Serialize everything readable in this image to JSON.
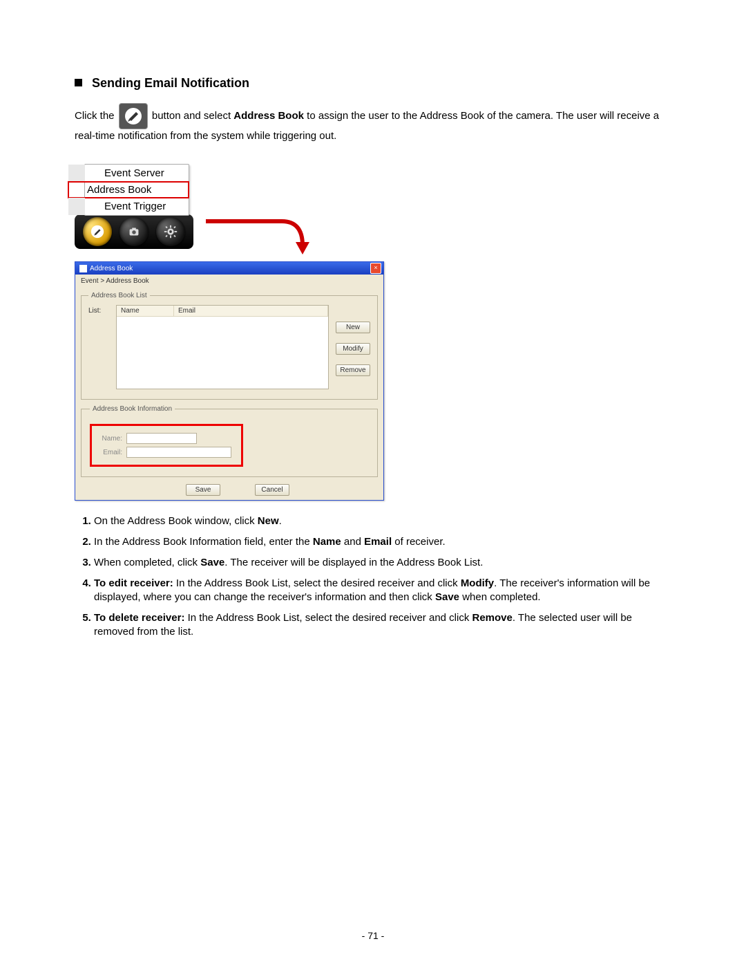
{
  "heading": "Sending Email Notification",
  "intro_before": "Click the ",
  "intro_after_btn_before_bold": " button and select ",
  "intro_bold1": "Address Book",
  "intro_after_bold1": " to assign the user to the Address Book of the camera. The user will receive a real-time notification from the system while triggering out.",
  "menu": {
    "items": [
      "Event Server",
      "Address Book",
      "Event Trigger"
    ],
    "selected_index": 1
  },
  "toolbar": {
    "icons": [
      "pencil-icon",
      "camera-icon",
      "gear-icon"
    ],
    "selected_index": 0
  },
  "dialog": {
    "title": "Address Book",
    "breadcrumb": "Event > Address Book",
    "list_group": "Address Book List",
    "list_label": "List:",
    "col_name": "Name",
    "col_email": "Email",
    "btn_new": "New",
    "btn_modify": "Modify",
    "btn_remove": "Remove",
    "info_group": "Address Book Information",
    "field_name": "Name:",
    "field_email": "Email:",
    "btn_save": "Save",
    "btn_cancel": "Cancel"
  },
  "steps": {
    "s1a": "On the Address Book window, click ",
    "s1b": "New",
    "s1c": ".",
    "s2a": "In the Address Book Information field, enter the ",
    "s2b": "Name",
    "s2c": " and ",
    "s2d": "Email",
    "s2e": " of receiver.",
    "s3a": "When completed, click ",
    "s3b": "Save",
    "s3c": ". The receiver will be displayed in the Address Book List.",
    "s4a": "To edit receiver:",
    "s4b": " In the Address Book List, select the desired receiver and click ",
    "s4c": "Modify",
    "s4d": ". The receiver's information will be displayed, where you can change the receiver's information and then click ",
    "s4e": "Save",
    "s4f": " when completed.",
    "s5a": "To delete receiver:",
    "s5b": " In the Address Book List, select the desired receiver and click ",
    "s5c": "Remove",
    "s5d": ". The selected user will be removed from the list."
  },
  "page_number": "- 71 -"
}
